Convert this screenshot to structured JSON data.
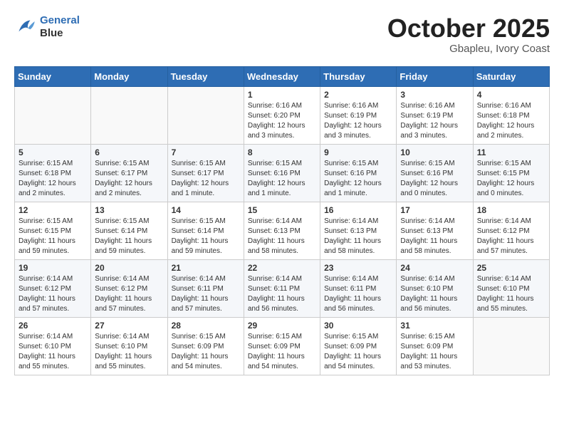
{
  "header": {
    "logo_line1": "General",
    "logo_line2": "Blue",
    "month": "October 2025",
    "location": "Gbapleu, Ivory Coast"
  },
  "weekdays": [
    "Sunday",
    "Monday",
    "Tuesday",
    "Wednesday",
    "Thursday",
    "Friday",
    "Saturday"
  ],
  "weeks": [
    [
      {
        "day": "",
        "info": ""
      },
      {
        "day": "",
        "info": ""
      },
      {
        "day": "",
        "info": ""
      },
      {
        "day": "1",
        "info": "Sunrise: 6:16 AM\nSunset: 6:20 PM\nDaylight: 12 hours\nand 3 minutes."
      },
      {
        "day": "2",
        "info": "Sunrise: 6:16 AM\nSunset: 6:19 PM\nDaylight: 12 hours\nand 3 minutes."
      },
      {
        "day": "3",
        "info": "Sunrise: 6:16 AM\nSunset: 6:19 PM\nDaylight: 12 hours\nand 3 minutes."
      },
      {
        "day": "4",
        "info": "Sunrise: 6:16 AM\nSunset: 6:18 PM\nDaylight: 12 hours\nand 2 minutes."
      }
    ],
    [
      {
        "day": "5",
        "info": "Sunrise: 6:15 AM\nSunset: 6:18 PM\nDaylight: 12 hours\nand 2 minutes."
      },
      {
        "day": "6",
        "info": "Sunrise: 6:15 AM\nSunset: 6:17 PM\nDaylight: 12 hours\nand 2 minutes."
      },
      {
        "day": "7",
        "info": "Sunrise: 6:15 AM\nSunset: 6:17 PM\nDaylight: 12 hours\nand 1 minute."
      },
      {
        "day": "8",
        "info": "Sunrise: 6:15 AM\nSunset: 6:16 PM\nDaylight: 12 hours\nand 1 minute."
      },
      {
        "day": "9",
        "info": "Sunrise: 6:15 AM\nSunset: 6:16 PM\nDaylight: 12 hours\nand 1 minute."
      },
      {
        "day": "10",
        "info": "Sunrise: 6:15 AM\nSunset: 6:16 PM\nDaylight: 12 hours\nand 0 minutes."
      },
      {
        "day": "11",
        "info": "Sunrise: 6:15 AM\nSunset: 6:15 PM\nDaylight: 12 hours\nand 0 minutes."
      }
    ],
    [
      {
        "day": "12",
        "info": "Sunrise: 6:15 AM\nSunset: 6:15 PM\nDaylight: 11 hours\nand 59 minutes."
      },
      {
        "day": "13",
        "info": "Sunrise: 6:15 AM\nSunset: 6:14 PM\nDaylight: 11 hours\nand 59 minutes."
      },
      {
        "day": "14",
        "info": "Sunrise: 6:15 AM\nSunset: 6:14 PM\nDaylight: 11 hours\nand 59 minutes."
      },
      {
        "day": "15",
        "info": "Sunrise: 6:14 AM\nSunset: 6:13 PM\nDaylight: 11 hours\nand 58 minutes."
      },
      {
        "day": "16",
        "info": "Sunrise: 6:14 AM\nSunset: 6:13 PM\nDaylight: 11 hours\nand 58 minutes."
      },
      {
        "day": "17",
        "info": "Sunrise: 6:14 AM\nSunset: 6:13 PM\nDaylight: 11 hours\nand 58 minutes."
      },
      {
        "day": "18",
        "info": "Sunrise: 6:14 AM\nSunset: 6:12 PM\nDaylight: 11 hours\nand 57 minutes."
      }
    ],
    [
      {
        "day": "19",
        "info": "Sunrise: 6:14 AM\nSunset: 6:12 PM\nDaylight: 11 hours\nand 57 minutes."
      },
      {
        "day": "20",
        "info": "Sunrise: 6:14 AM\nSunset: 6:12 PM\nDaylight: 11 hours\nand 57 minutes."
      },
      {
        "day": "21",
        "info": "Sunrise: 6:14 AM\nSunset: 6:11 PM\nDaylight: 11 hours\nand 57 minutes."
      },
      {
        "day": "22",
        "info": "Sunrise: 6:14 AM\nSunset: 6:11 PM\nDaylight: 11 hours\nand 56 minutes."
      },
      {
        "day": "23",
        "info": "Sunrise: 6:14 AM\nSunset: 6:11 PM\nDaylight: 11 hours\nand 56 minutes."
      },
      {
        "day": "24",
        "info": "Sunrise: 6:14 AM\nSunset: 6:10 PM\nDaylight: 11 hours\nand 56 minutes."
      },
      {
        "day": "25",
        "info": "Sunrise: 6:14 AM\nSunset: 6:10 PM\nDaylight: 11 hours\nand 55 minutes."
      }
    ],
    [
      {
        "day": "26",
        "info": "Sunrise: 6:14 AM\nSunset: 6:10 PM\nDaylight: 11 hours\nand 55 minutes."
      },
      {
        "day": "27",
        "info": "Sunrise: 6:14 AM\nSunset: 6:10 PM\nDaylight: 11 hours\nand 55 minutes."
      },
      {
        "day": "28",
        "info": "Sunrise: 6:15 AM\nSunset: 6:09 PM\nDaylight: 11 hours\nand 54 minutes."
      },
      {
        "day": "29",
        "info": "Sunrise: 6:15 AM\nSunset: 6:09 PM\nDaylight: 11 hours\nand 54 minutes."
      },
      {
        "day": "30",
        "info": "Sunrise: 6:15 AM\nSunset: 6:09 PM\nDaylight: 11 hours\nand 54 minutes."
      },
      {
        "day": "31",
        "info": "Sunrise: 6:15 AM\nSunset: 6:09 PM\nDaylight: 11 hours\nand 53 minutes."
      },
      {
        "day": "",
        "info": ""
      }
    ]
  ]
}
